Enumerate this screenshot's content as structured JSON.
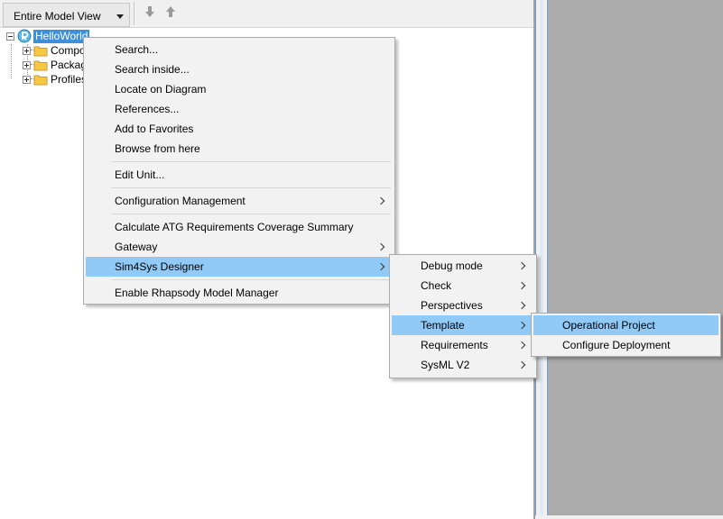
{
  "toolbar": {
    "view_select": "Entire Model View",
    "nav_down_icon": "arrow-down-icon",
    "nav_up_icon": "arrow-up-icon"
  },
  "tree": {
    "root_label": "HelloWorld",
    "children": [
      {
        "label": "Components"
      },
      {
        "label": "Packages"
      },
      {
        "label": "Profiles"
      }
    ]
  },
  "context_menu": {
    "items": [
      {
        "label": "Search..."
      },
      {
        "label": "Search inside..."
      },
      {
        "label": "Locate on Diagram"
      },
      {
        "label": "References..."
      },
      {
        "label": "Add to Favorites"
      },
      {
        "label": "Browse from here"
      },
      {
        "label": "Edit Unit..."
      },
      {
        "label": "Configuration Management"
      },
      {
        "label": "Calculate ATG Requirements Coverage Summary"
      },
      {
        "label": "Gateway"
      },
      {
        "label": "Sim4Sys Designer"
      },
      {
        "label": "Enable Rhapsody Model Manager"
      }
    ]
  },
  "submenu_sim4sys": {
    "items": [
      {
        "label": "Debug mode"
      },
      {
        "label": "Check"
      },
      {
        "label": "Perspectives"
      },
      {
        "label": "Template"
      },
      {
        "label": "Requirements"
      },
      {
        "label": "SysML V2"
      }
    ]
  },
  "submenu_template": {
    "items": [
      {
        "label": "Operational Project"
      },
      {
        "label": "Configure Deployment"
      }
    ]
  },
  "colors": {
    "highlight": "#91c9f7",
    "selection": "#3c8fd8",
    "menu_bg": "#f2f2f2",
    "gray_area": "#ababab"
  }
}
